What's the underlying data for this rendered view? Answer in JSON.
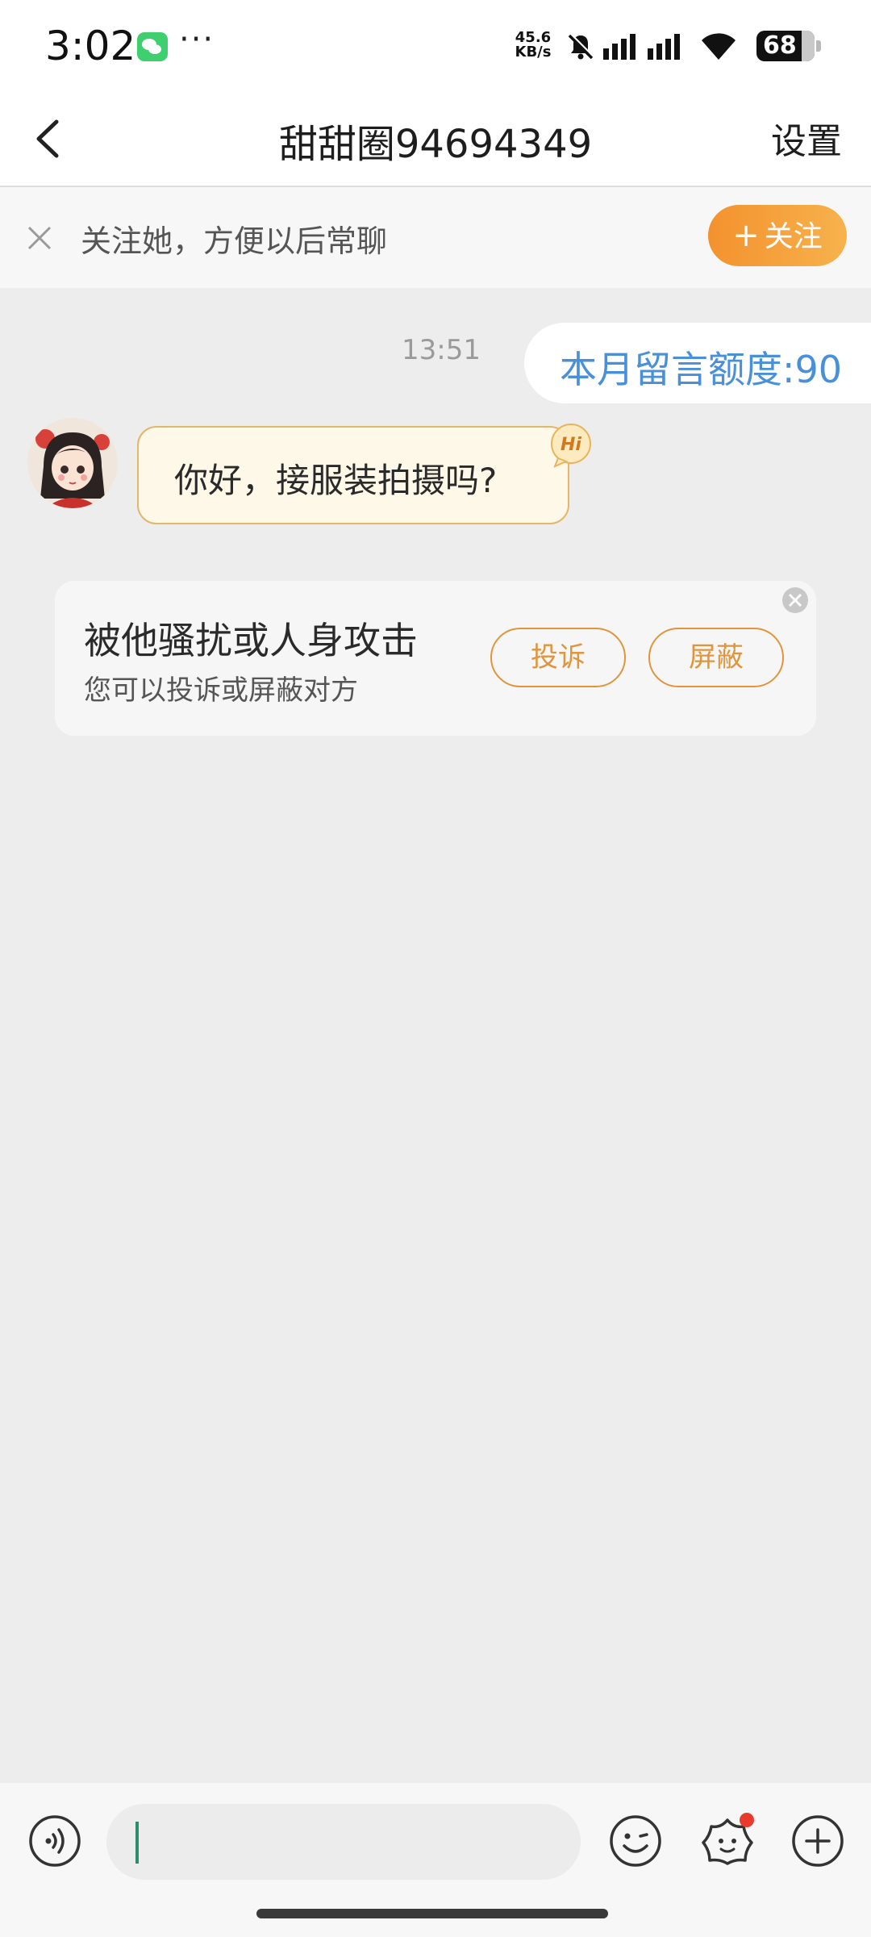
{
  "status_bar": {
    "time": "3:02",
    "more": "···",
    "net_speed_value": "45.6",
    "net_speed_unit": "KB/s",
    "battery": "68"
  },
  "nav": {
    "title": "甜甜圈94694349",
    "settings": "设置"
  },
  "follow_bar": {
    "tip": "关注她，方便以后常聊",
    "button_plus": "+",
    "button_label": "关注"
  },
  "messages": {
    "time": "13:51",
    "quota": "本月留言额度:90",
    "incoming_text": "你好，接服装拍摄吗?"
  },
  "report_card": {
    "title": "被他骚扰或人身攻击",
    "subtitle": "您可以投诉或屏蔽对方",
    "complain": "投诉",
    "block": "屏蔽"
  },
  "hi_badge": "Hi",
  "input": {
    "value": ""
  },
  "colors": {
    "accent_orange": "#f3922e",
    "quota_blue": "#4a90d9",
    "bubble_bg": "#fef8e8",
    "notification_red": "#e83b2e"
  }
}
